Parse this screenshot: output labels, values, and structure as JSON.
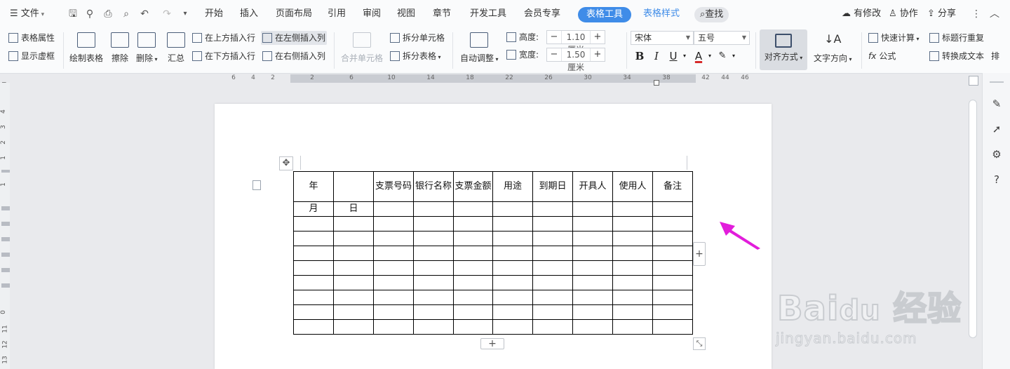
{
  "menu": {
    "file": "文件",
    "tabs": [
      "开始",
      "插入",
      "页面布局",
      "引用",
      "审阅",
      "视图",
      "章节",
      "开发工具",
      "会员专享"
    ],
    "active_tab": "表格工具",
    "style_tab": "表格样式",
    "search": "查找",
    "right": {
      "modified": "有修改",
      "collab": "协作",
      "share": "分享"
    }
  },
  "ribbon": {
    "table_props": "表格属性",
    "show_gridlines": "显示虚框",
    "draw_table": "绘制表格",
    "erase": "擦除",
    "delete": "删除",
    "summary": "汇总",
    "insert_above": "在上方插入行",
    "insert_below": "在下方插入行",
    "insert_left": "在左侧插入列",
    "insert_right": "在右侧插入列",
    "merge_cells": "合并单元格",
    "split_cells": "拆分单元格",
    "split_table": "拆分表格",
    "auto_fit": "自动调整",
    "height_label": "高度:",
    "height_value": "1.10厘米",
    "width_label": "宽度:",
    "width_value": "1.50厘米",
    "font_name": "宋体",
    "font_size": "五号",
    "align": "对齐方式",
    "text_dir": "文字方向",
    "quick_calc": "快速计算",
    "formula": "公式",
    "header_repeat": "标题行重复",
    "to_text": "转换成文本",
    "sort_partial": "排"
  },
  "ruler": {
    "h_ticks": [
      "6",
      "4",
      "2",
      "2",
      "6",
      "10",
      "14",
      "18",
      "22",
      "26",
      "30",
      "34",
      "38",
      "42",
      "44",
      "46"
    ],
    "v_ticks": [
      "4",
      "3",
      "2",
      "1",
      "1",
      "0",
      "11",
      "12",
      "13"
    ]
  },
  "table": {
    "header": [
      "年",
      "",
      "支票号码",
      "银行名称",
      "支票金额",
      "用途",
      "到期日",
      "开具人",
      "使用人",
      "备注"
    ],
    "subheader": [
      "月",
      "日",
      "",
      "",
      "",
      "",
      "",
      "",
      "",
      ""
    ],
    "empty_rows": 8
  },
  "colors": {
    "accent": "#3f8ce8",
    "arrow": "#e21ddb"
  }
}
